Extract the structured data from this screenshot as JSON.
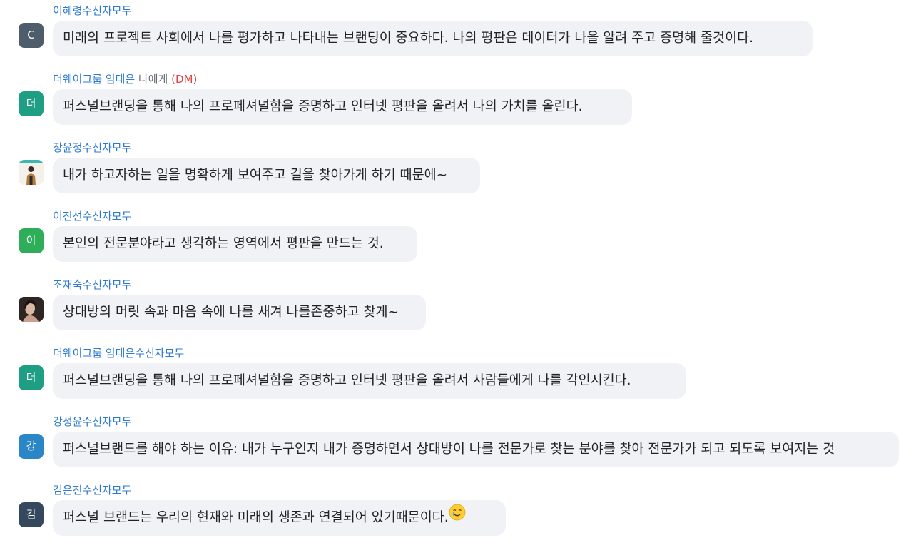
{
  "messages": [
    {
      "sender": "이혜령",
      "recipient": "수신자모두",
      "dm": false,
      "avatar": {
        "type": "initial",
        "initial": "C",
        "color": "#4e5d6b"
      },
      "text": "미래의 프로젝트 사회에서 나를 평가하고 나타내는 브랜딩이 중요하다. 나의 평판은 데이터가 나을 알려 주고 증명해 줄것이다."
    },
    {
      "sender": "더웨이그룹 임태은",
      "recipient": " 나에게 ",
      "dm": true,
      "dm_tag": "(DM)",
      "avatar": {
        "type": "initial",
        "initial": "더",
        "color": "#1e9e82"
      },
      "text": "퍼스널브랜딩을 통해 나의 프로페셔널함을 증명하고 인터넷 평판을 올려서 나의 가치를 올린다."
    },
    {
      "sender": "장윤정",
      "recipient": "수신자모두",
      "dm": false,
      "avatar": {
        "type": "photo",
        "initial": "",
        "color": "#e9e4dc"
      },
      "text": "내가 하고자하는 일을 명확하게 보여주고 길을 찾아가게 하기 때문에~"
    },
    {
      "sender": "이진선",
      "recipient": "수신자모두",
      "dm": false,
      "avatar": {
        "type": "initial",
        "initial": "이",
        "color": "#2fae5a"
      },
      "text": "본인의 전문분야라고 생각하는 영역에서 평판을 만드는 것."
    },
    {
      "sender": "조재숙",
      "recipient": "수신자모두",
      "dm": false,
      "avatar": {
        "type": "photo",
        "initial": "",
        "color": "#3a3230"
      },
      "text": "상대방의 머릿 속과 마음 속에 나를 새겨 나를존중하고 찾게~"
    },
    {
      "sender": "더웨이그룹 임태은",
      "recipient": "수신자모두",
      "dm": false,
      "avatar": {
        "type": "initial",
        "initial": "더",
        "color": "#1e9e82"
      },
      "text": "퍼스널브랜딩을 통해 나의 프로페셔널함을 증명하고 인터넷 평판을 올려서 사람들에게 나를 각인시킨다."
    },
    {
      "sender": "강성윤",
      "recipient": "수신자모두",
      "dm": false,
      "avatar": {
        "type": "initial",
        "initial": "강",
        "color": "#2a86c7"
      },
      "text": "퍼스널브랜드를 해야 하는 이유: 내가 누구인지 내가 증명하면서 상대방이 나를 전문가로 찾는 분야를 찾아 전문가가 되고 되도록 보여지는 것"
    },
    {
      "sender": "김은진",
      "recipient": "수신자모두",
      "dm": false,
      "avatar": {
        "type": "initial",
        "initial": "김",
        "color": "#34495e"
      },
      "text": "퍼스널 브랜드는 우리의 현재와 미래의 생존과 연결되어 있기때문이다.",
      "emoji": "smiling-face-with-tear-icon"
    }
  ]
}
